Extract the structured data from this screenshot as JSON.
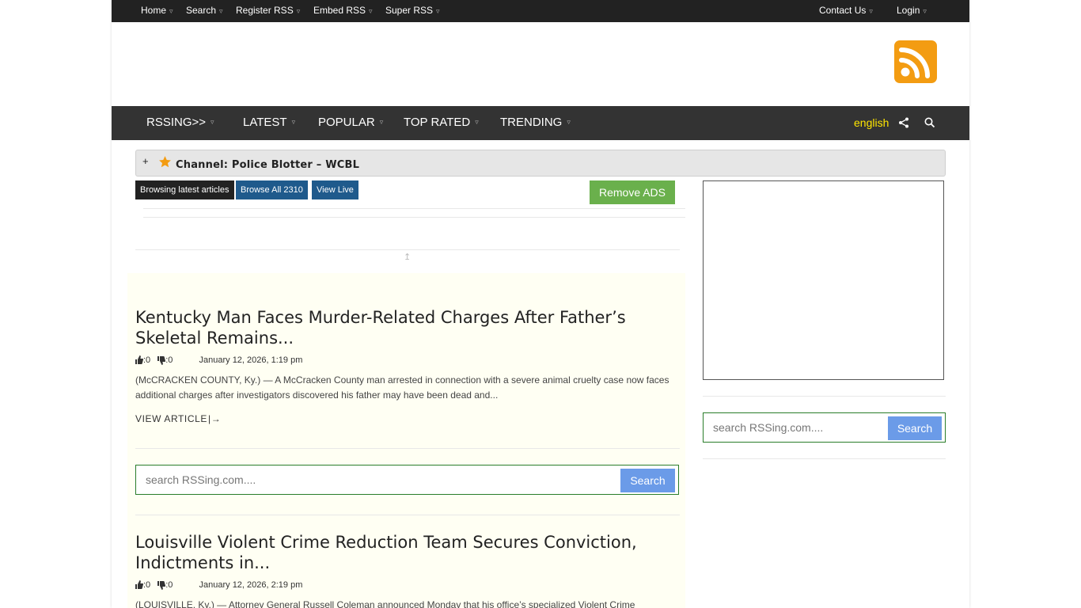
{
  "topbar": {
    "left": [
      {
        "label": "Home"
      },
      {
        "label": "Search"
      },
      {
        "label": "Register RSS"
      },
      {
        "label": "Embed RSS"
      },
      {
        "label": "Super RSS"
      }
    ],
    "right": [
      {
        "label": "Contact Us"
      },
      {
        "label": "Login"
      }
    ],
    "caret": "▿"
  },
  "nav": {
    "items": [
      {
        "label": "RSSING>>"
      },
      {
        "label": "LATEST"
      },
      {
        "label": "POPULAR"
      },
      {
        "label": "TOP RATED"
      },
      {
        "label": "TRENDING"
      }
    ],
    "language": "english",
    "icons": [
      "share-icon",
      "search-icon"
    ]
  },
  "channel": {
    "plus": "+",
    "title": "Channel: Police Blotter – WCBL"
  },
  "tabs": {
    "browsing": "Browsing latest articles",
    "browse_all": "Browse All 2310",
    "view_live": "View Live",
    "remove_ads": "Remove ADS"
  },
  "marker": "↥",
  "articles": [
    {
      "title": "Kentucky Man Faces Murder-Related Charges After Father’s Skeletal Remains...",
      "likes": ":0",
      "dislikes": ":0",
      "date": "January 12, 2026, 1:19 pm",
      "excerpt": "(McCRACKEN COUNTY, Ky.) — A McCracken County man arrested in connection with a severe animal cruelty case now faces additional charges after investigators discovered his father may have been dead and...",
      "view": "VIEW ARTICLE"
    },
    {
      "title": "Louisville Violent Crime Reduction Team Secures Conviction, Indictments in...",
      "likes": ":0",
      "dislikes": ":0",
      "date": "January 12, 2026, 2:19 pm",
      "excerpt": "(LOUISVILLE, Ky.) — Attorney General Russell Coleman announced Monday that his office’s specialized Violent Crime"
    }
  ],
  "search": {
    "placeholder": "search RSSing.com....",
    "button": "Search"
  },
  "colors": {
    "topbar": "#222222",
    "navbar": "#333333",
    "rss_orange": "#f39c12",
    "browse_blue": "#1f5a8c",
    "remove_ads_green": "#6ab04c",
    "search_button": "#6b9be8",
    "language": "#ffe600"
  }
}
